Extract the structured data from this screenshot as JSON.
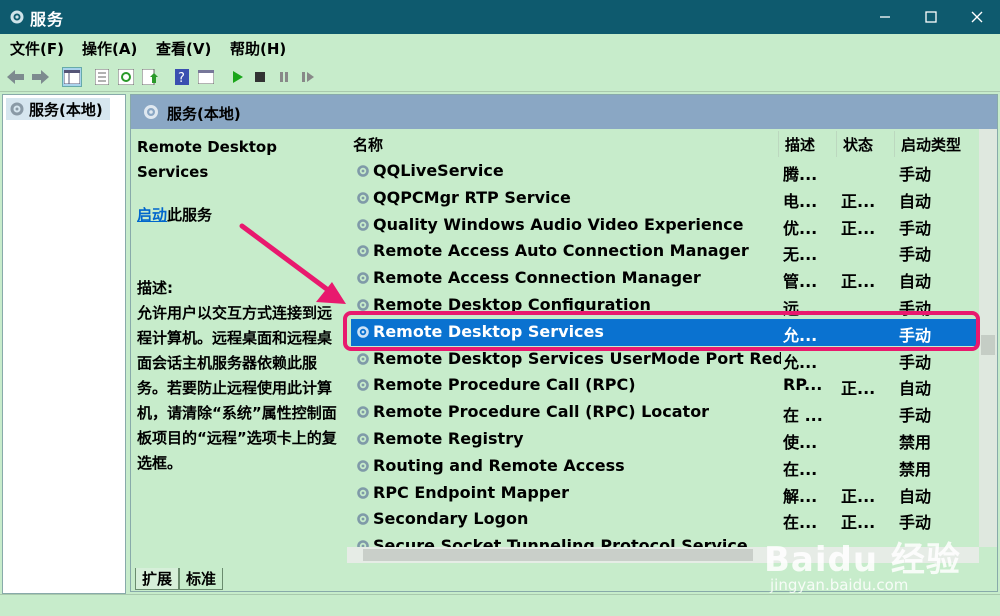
{
  "window": {
    "title": "服务"
  },
  "menu": [
    "文件(F)",
    "操作(A)",
    "查看(V)",
    "帮助(H)"
  ],
  "tree": {
    "item": "服务(本地)"
  },
  "pane": {
    "header": "服务(本地)"
  },
  "detail": {
    "service_name": "Remote Desktop Services",
    "start_link": "启动",
    "start_suffix": "此服务",
    "desc_label": "描述:",
    "desc_text": "允许用户以交互方式连接到远程计算机。远程桌面和远程桌面会话主机服务器依赖此服务。若要防止远程使用此计算机，请清除“系统”属性控制面板项目的“远程”选项卡上的复选框。"
  },
  "columns": {
    "name": "名称",
    "desc": "描述",
    "status": "状态",
    "startup": "启动类型"
  },
  "rows": [
    {
      "name": "QQLiveService",
      "desc": "腾...",
      "status": "",
      "startup": "手动"
    },
    {
      "name": "QQPCMgr RTP Service",
      "desc": "电...",
      "status": "正...",
      "startup": "自动"
    },
    {
      "name": "Quality Windows Audio Video Experience",
      "desc": "优...",
      "status": "正...",
      "startup": "手动"
    },
    {
      "name": "Remote Access Auto Connection Manager",
      "desc": "无...",
      "status": "",
      "startup": "手动"
    },
    {
      "name": "Remote Access Connection Manager",
      "desc": "管...",
      "status": "正...",
      "startup": "自动"
    },
    {
      "name": "Remote Desktop Configuration",
      "desc": "远...",
      "status": "",
      "startup": "手动"
    },
    {
      "name": "Remote Desktop Services",
      "desc": "允...",
      "status": "",
      "startup": "手动"
    },
    {
      "name": "Remote Desktop Services UserMode Port Redi...",
      "desc": "允...",
      "status": "",
      "startup": "手动"
    },
    {
      "name": "Remote Procedure Call (RPC)",
      "desc": "RP...",
      "status": "正...",
      "startup": "自动"
    },
    {
      "name": "Remote Procedure Call (RPC) Locator",
      "desc": "在 ...",
      "status": "",
      "startup": "手动"
    },
    {
      "name": "Remote Registry",
      "desc": "使...",
      "status": "",
      "startup": "禁用"
    },
    {
      "name": "Routing and Remote Access",
      "desc": "在...",
      "status": "",
      "startup": "禁用"
    },
    {
      "name": "RPC Endpoint Mapper",
      "desc": "解...",
      "status": "正...",
      "startup": "自动"
    },
    {
      "name": "Secondary Logon",
      "desc": "在...",
      "status": "正...",
      "startup": "手动"
    },
    {
      "name": "Secure Socket Tunneling Protocol Service",
      "desc": "",
      "status": "",
      "startup": ""
    }
  ],
  "selected_row": "Remote Desktop Services",
  "tabs": [
    "扩展",
    "标准"
  ],
  "watermark": {
    "brand": "Baidu 经验",
    "url": "jingyan.baidu.com"
  },
  "colors": {
    "selection": "#0a72d0",
    "highlight": "#e8196e",
    "background": "#c7eccb",
    "titlebar": "#0e5a6e"
  }
}
